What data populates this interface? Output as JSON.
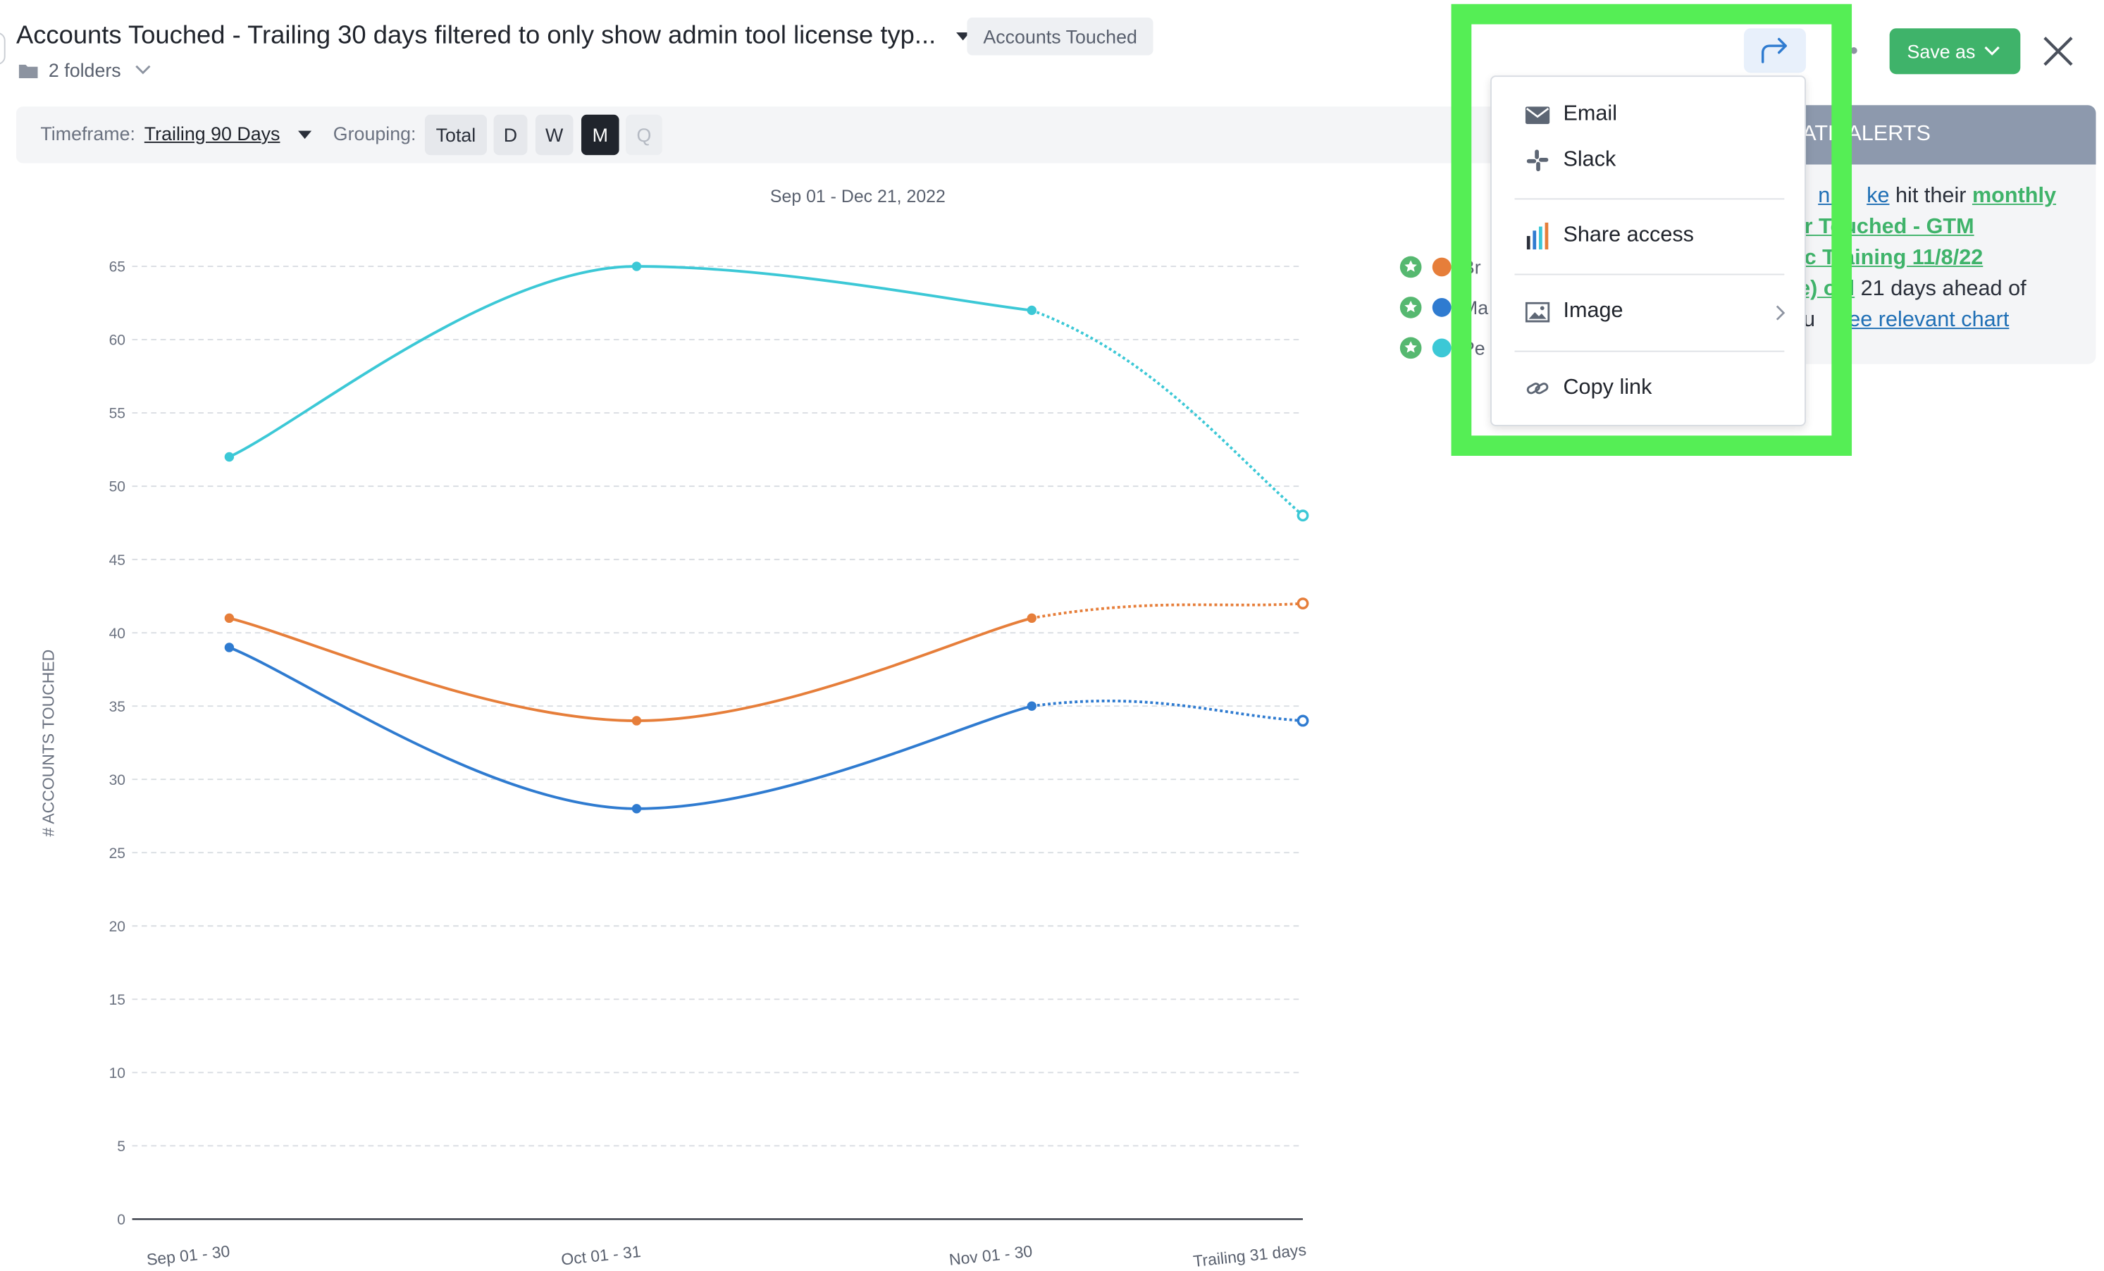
{
  "header": {
    "title": "Accounts Touched - Trailing 30 days filtered to only show admin tool license typ...",
    "tag": "Accounts Touched",
    "folders": "2 folders"
  },
  "toolbar": {
    "timeframe_label": "Timeframe:",
    "timeframe_value": "Trailing 90 Days",
    "grouping_label": "Grouping:",
    "grouping_options": [
      "Total",
      "D",
      "W",
      "M",
      "Q"
    ],
    "grouping_selected": "M"
  },
  "actions": {
    "save_label": "Save as"
  },
  "share_menu": {
    "items": [
      {
        "label": "Email",
        "icon": "email-icon"
      },
      {
        "label": "Slack",
        "icon": "slack-icon"
      },
      {
        "label": "Share access",
        "icon": "bar-chart-icon"
      },
      {
        "label": "Image",
        "icon": "image-icon"
      },
      {
        "label": "Copy link",
        "icon": "link-icon"
      }
    ]
  },
  "alerts": {
    "heading_visible": "ATE ALERTS",
    "line1a": "n B",
    "line1b": "ke",
    "line1c": " hit their ",
    "line1d": "monthly",
    "line2": "ur  Touched - GTM",
    "line3": "uc Training 11/8/22",
    "line4a": "te) oal",
    "line4b": " 21 days ahead of",
    "line5a": "du",
    "line5b": "See relevant chart"
  },
  "legend": {
    "items": [
      {
        "label": "Br",
        "color": "#e67e3a"
      },
      {
        "label": "Ma",
        "color": "#2f7bd0"
      },
      {
        "label": "Pe",
        "color": "#3cc8d6"
      }
    ]
  },
  "chart_data": {
    "type": "line",
    "subtitle": "Sep 01 - Dec 21, 2022",
    "ylabel": "# ACCOUNTS TOUCHED",
    "categories": [
      "Sep 01 - 30",
      "Oct 01 - 31",
      "Nov 01 - 30",
      "Trailing 31 days"
    ],
    "ylim": [
      0,
      65
    ],
    "yticks": [
      0,
      5,
      10,
      15,
      20,
      25,
      30,
      35,
      40,
      45,
      50,
      55,
      60,
      65
    ],
    "grid": true,
    "projected_last_point": true,
    "series": [
      {
        "values": [
          41,
          34,
          41,
          42
        ],
        "color": "#e67e3a"
      },
      {
        "values": [
          39,
          28,
          35,
          34
        ],
        "color": "#2f7bd0"
      },
      {
        "values": [
          52,
          65,
          62,
          48
        ],
        "color": "#3cc8d6"
      }
    ]
  }
}
